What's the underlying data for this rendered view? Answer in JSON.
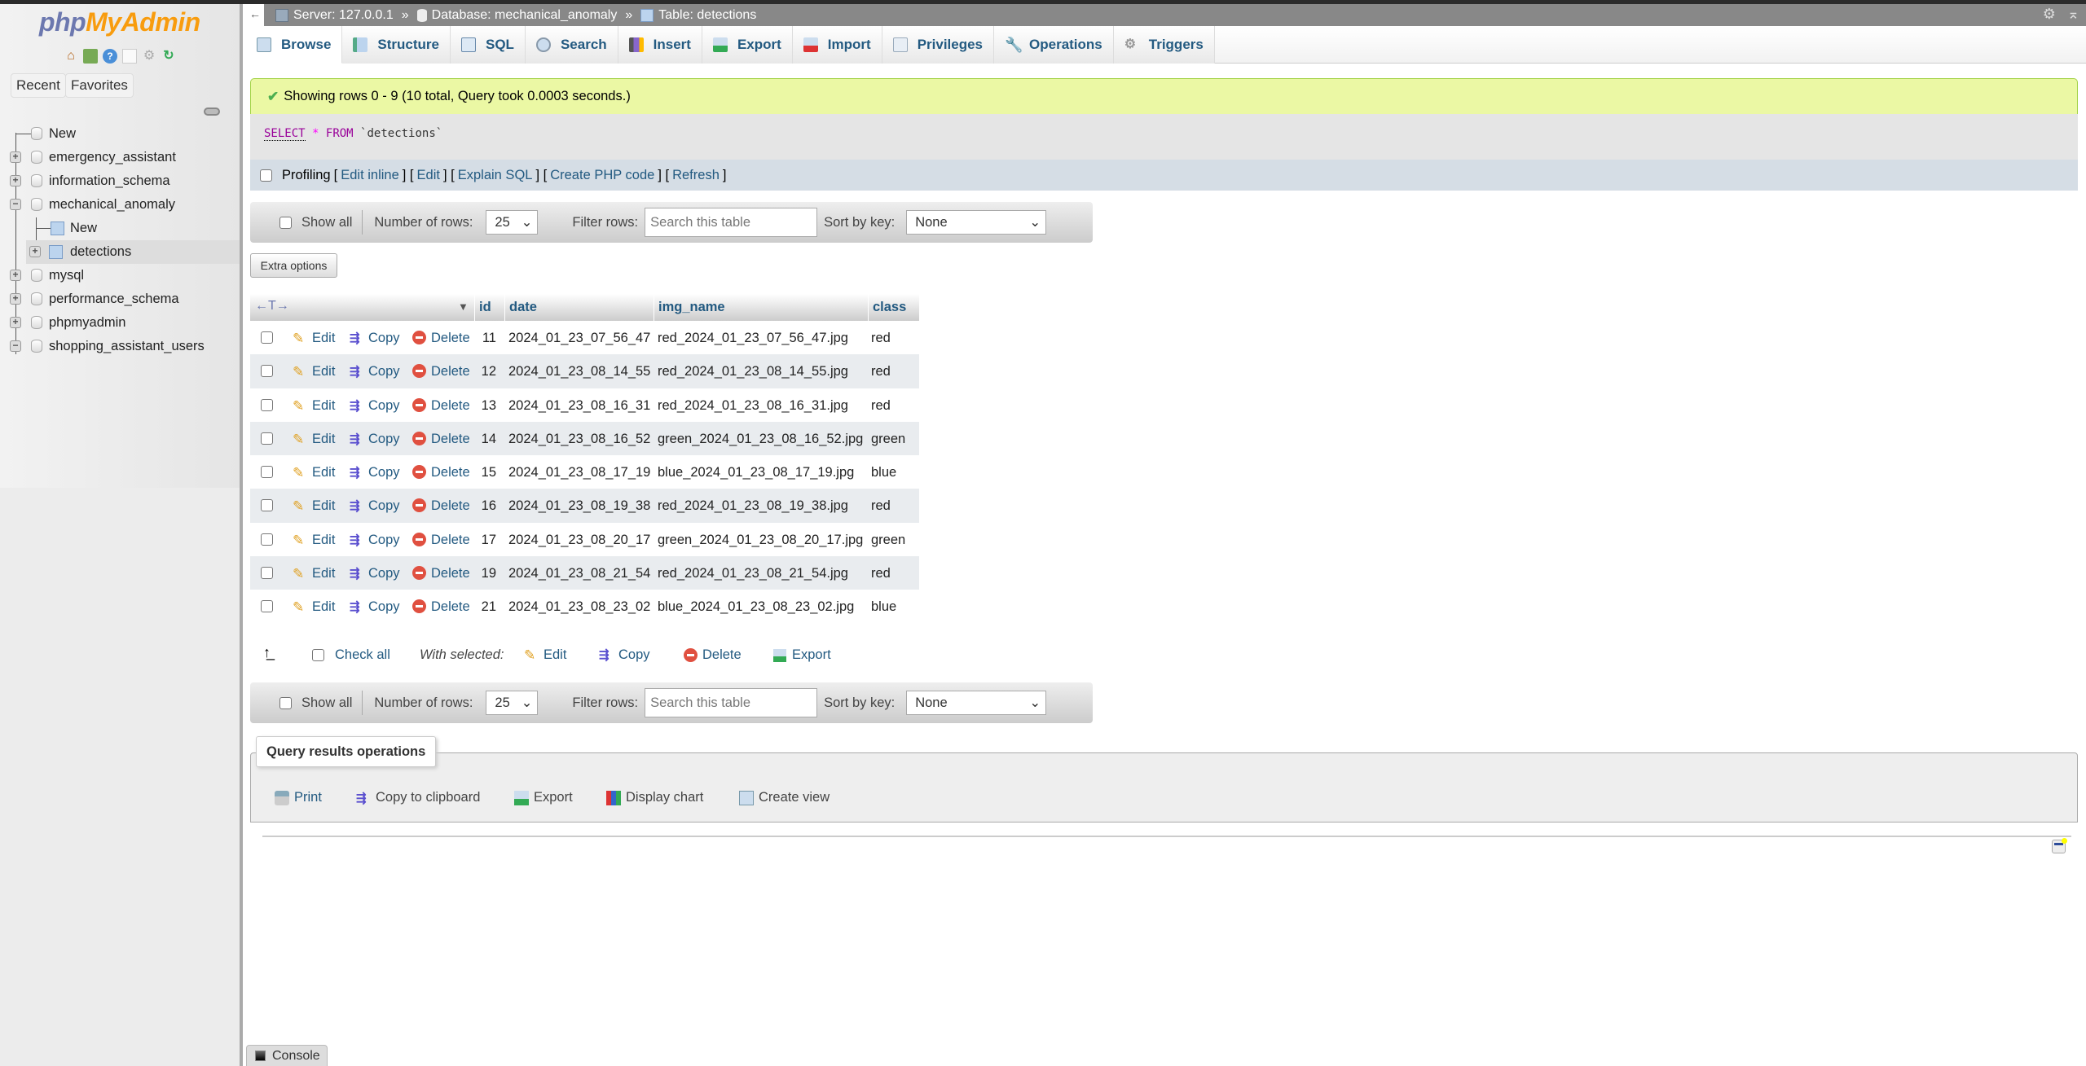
{
  "app": {
    "logo_php": "php",
    "logo_myadmin": "MyAdmin"
  },
  "sidebar": {
    "quick_icons": [
      "home-icon",
      "logout-icon",
      "help-icon",
      "docs-icon",
      "settings-icon",
      "reload-icon"
    ],
    "tabs": {
      "recent": "Recent",
      "favorites": "Favorites"
    },
    "tree": [
      {
        "label": "New",
        "type": "new-db"
      },
      {
        "label": "emergency_assistant",
        "type": "db",
        "expander": "+"
      },
      {
        "label": "information_schema",
        "type": "db",
        "expander": "+"
      },
      {
        "label": "mechanical_anomaly",
        "type": "db",
        "expander": "−"
      },
      {
        "label": "New",
        "type": "new-table"
      },
      {
        "label": "detections",
        "type": "table",
        "expander": "+"
      },
      {
        "label": "mysql",
        "type": "db",
        "expander": "+"
      },
      {
        "label": "performance_schema",
        "type": "db",
        "expander": "+"
      },
      {
        "label": "phpmyadmin",
        "type": "db",
        "expander": "+"
      },
      {
        "label": "shopping_assistant_users",
        "type": "db",
        "expander": "−"
      }
    ]
  },
  "breadcrumb": {
    "back": "←",
    "server": "Server: 127.0.0.1",
    "database": "Database: mechanical_anomaly",
    "table": "Table: detections",
    "separator": "»"
  },
  "tabs": [
    {
      "label": "Browse",
      "icon": "browse-icon",
      "active": true
    },
    {
      "label": "Structure",
      "icon": "structure-icon"
    },
    {
      "label": "SQL",
      "icon": "sql-icon"
    },
    {
      "label": "Search",
      "icon": "search-icon"
    },
    {
      "label": "Insert",
      "icon": "insert-icon"
    },
    {
      "label": "Export",
      "icon": "export-icon"
    },
    {
      "label": "Import",
      "icon": "import-icon"
    },
    {
      "label": "Privileges",
      "icon": "privileges-icon"
    },
    {
      "label": "Operations",
      "icon": "operations-icon"
    },
    {
      "label": "Triggers",
      "icon": "triggers-icon"
    }
  ],
  "message": {
    "success": "Showing rows 0 - 9 (10 total, Query took 0.0003 seconds.)"
  },
  "sql": {
    "select": "SELECT",
    "star": "*",
    "from": "FROM",
    "table": "`detections`"
  },
  "profiling": {
    "label": "Profiling",
    "links": [
      "Edit inline",
      "Edit",
      "Explain SQL",
      "Create PHP code",
      "Refresh"
    ]
  },
  "nav": {
    "show_all": "Show all",
    "num_rows_label": "Number of rows:",
    "num_rows_value": "25",
    "filter_label": "Filter rows:",
    "filter_placeholder": "Search this table",
    "sort_label": "Sort by key:",
    "sort_value": "None"
  },
  "extra_options": "Extra options",
  "table": {
    "columns": [
      "id",
      "date",
      "img_name",
      "class"
    ],
    "actions": {
      "edit": "Edit",
      "copy": "Copy",
      "delete": "Delete"
    },
    "rows": [
      {
        "id": "11",
        "date": "2024_01_23_07_56_47",
        "img_name": "red_2024_01_23_07_56_47.jpg",
        "class": "red"
      },
      {
        "id": "12",
        "date": "2024_01_23_08_14_55",
        "img_name": "red_2024_01_23_08_14_55.jpg",
        "class": "red"
      },
      {
        "id": "13",
        "date": "2024_01_23_08_16_31",
        "img_name": "red_2024_01_23_08_16_31.jpg",
        "class": "red"
      },
      {
        "id": "14",
        "date": "2024_01_23_08_16_52",
        "img_name": "green_2024_01_23_08_16_52.jpg",
        "class": "green"
      },
      {
        "id": "15",
        "date": "2024_01_23_08_17_19",
        "img_name": "blue_2024_01_23_08_17_19.jpg",
        "class": "blue"
      },
      {
        "id": "16",
        "date": "2024_01_23_08_19_38",
        "img_name": "red_2024_01_23_08_19_38.jpg",
        "class": "red"
      },
      {
        "id": "17",
        "date": "2024_01_23_08_20_17",
        "img_name": "green_2024_01_23_08_20_17.jpg",
        "class": "green"
      },
      {
        "id": "19",
        "date": "2024_01_23_08_21_54",
        "img_name": "red_2024_01_23_08_21_54.jpg",
        "class": "red"
      },
      {
        "id": "21",
        "date": "2024_01_23_08_23_02",
        "img_name": "blue_2024_01_23_08_23_02.jpg",
        "class": "blue"
      }
    ]
  },
  "with_selected": {
    "check_all": "Check all",
    "label": "With selected:",
    "edit": "Edit",
    "copy": "Copy",
    "delete": "Delete",
    "export": "Export"
  },
  "query_ops": {
    "legend": "Query results operations",
    "print": "Print",
    "copy_clipboard": "Copy to clipboard",
    "export": "Export",
    "display_chart": "Display chart",
    "create_view": "Create view"
  },
  "console": "Console",
  "colors": {
    "link": "#235a81",
    "success_bg": "#ebf8a4",
    "success_border": "#a2d246",
    "logo_php": "#6c78af",
    "logo_myadmin": "#f89c0e"
  }
}
